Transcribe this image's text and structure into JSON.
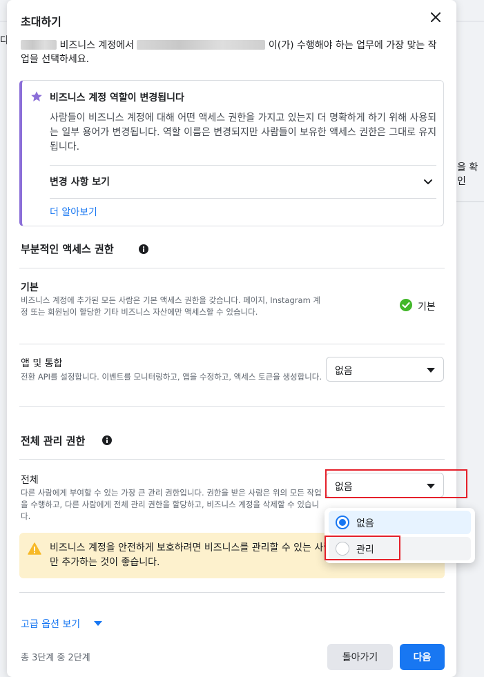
{
  "background": {
    "left_snippet": "다",
    "right_snippet": "을 확인"
  },
  "dialog": {
    "title": "초대하기",
    "desc_part1": "비즈니스 계정에서",
    "desc_part2": "이(가) 수행해야 하는 업무에 가장 맞는 작업을 선택하세요."
  },
  "notice": {
    "heading": "비즈니스 계정 역할이 변경됩니다",
    "body": "사람들이 비즈니스 계정에 대해 어떤 액세스 권한을 가지고 있는지 더 명확하게 하기 위해 사용되는 일부 용어가 변경됩니다. 역할 이름은 변경되지만 사람들이 보유한 액세스 권한은 그대로 유지됩니다.",
    "changes_label": "변경 사항 보기",
    "learn_more": "더 알아보기"
  },
  "partial": {
    "heading": "부분적인 액세스 권한",
    "basic": {
      "title": "기본",
      "desc": "비즈니스 계정에 추가된 모든 사람은 기본 액세스 권한을 갖습니다. 페이지, Instagram 계정 또는 회원님이 할당한 기타 비즈니스 자산에만 액세스할 수 있습니다.",
      "status": "기본"
    },
    "apps": {
      "title": "앱 및 통합",
      "desc": "전환 API를 설정합니다. 이벤트를 모니터링하고, 앱을 수정하고, 액세스 토큰을 생성합니다.",
      "selected": "없음"
    }
  },
  "full": {
    "heading": "전체 관리 권한",
    "all": {
      "title": "전체",
      "desc": "다른 사람에게 부여할 수 있는 가장 큰 관리 권한입니다. 권한을 받은 사람은 위의 모든 작업을 수행하고, 다른 사람에게 전체 관리 권한을 할당하고, 비즈니스 계정을 삭제할 수 있습니다.",
      "selected": "없음"
    },
    "warning": "비즈니스 계정을 안전하게 보호하려면 비즈니스를 관리할 수 있는 사람만 추가하는 것이 좋습니다."
  },
  "dropdown": {
    "options": [
      "없음",
      "관리"
    ],
    "selected_index": 0
  },
  "footer": {
    "advanced": "고급 옵션 보기",
    "step": "총 3단계 중 2단계",
    "back": "돌아가기",
    "next": "다음"
  }
}
